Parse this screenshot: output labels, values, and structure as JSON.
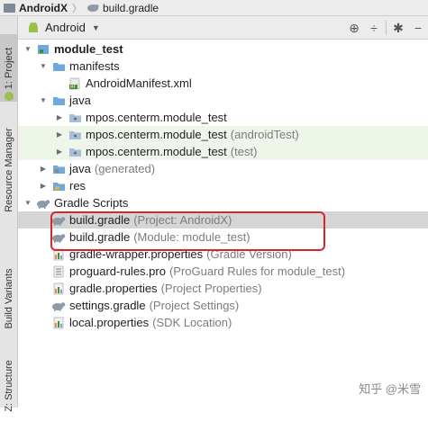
{
  "breadcrumb": {
    "project": "AndroidX",
    "file": "build.gradle"
  },
  "left_tabs": [
    {
      "label": "1: Project"
    },
    {
      "label": "Resource Manager"
    },
    {
      "label": "Build Variants"
    },
    {
      "label": "Z: Structure"
    }
  ],
  "header": {
    "view_mode": "Android",
    "tool_icons": [
      "target-icon",
      "collapse-icon",
      "gear-icon",
      "hide-icon"
    ]
  },
  "tree": [
    {
      "label": "module_test",
      "suffix": "",
      "bold": true,
      "level": 0,
      "arrow": "down",
      "icon": "module-icon"
    },
    {
      "label": "manifests",
      "suffix": "",
      "level": 1,
      "arrow": "down",
      "icon": "folder-icon"
    },
    {
      "label": "AndroidManifest.xml",
      "suffix": "",
      "level": 2,
      "arrow": "",
      "icon": "manifest-icon"
    },
    {
      "label": "java",
      "suffix": "",
      "level": 1,
      "arrow": "down",
      "icon": "folder-icon"
    },
    {
      "label": "mpos.centerm.module_test",
      "suffix": "",
      "level": 2,
      "arrow": "right",
      "icon": "package-icon"
    },
    {
      "label": "mpos.centerm.module_test",
      "suffix": "(androidTest)",
      "level": 2,
      "arrow": "right",
      "icon": "package-icon",
      "test": true
    },
    {
      "label": "mpos.centerm.module_test",
      "suffix": "(test)",
      "level": 2,
      "arrow": "right",
      "icon": "package-icon",
      "test": true
    },
    {
      "label": "java",
      "suffix": "(generated)",
      "level": 1,
      "arrow": "right",
      "icon": "generated-folder-icon"
    },
    {
      "label": "res",
      "suffix": "",
      "level": 1,
      "arrow": "right",
      "icon": "res-folder-icon"
    },
    {
      "label": "Gradle Scripts",
      "suffix": "",
      "level": 0,
      "arrow": "down",
      "icon": "gradle-icon"
    },
    {
      "label": "build.gradle",
      "suffix": "(Project: AndroidX)",
      "level": 1,
      "arrow": "",
      "icon": "gradle-icon",
      "selected": true
    },
    {
      "label": "build.gradle",
      "suffix": "(Module: module_test)",
      "level": 1,
      "arrow": "",
      "icon": "gradle-icon"
    },
    {
      "label": "gradle-wrapper.properties",
      "suffix": "(Gradle Version)",
      "level": 1,
      "arrow": "",
      "icon": "properties-icon"
    },
    {
      "label": "proguard-rules.pro",
      "suffix": "(ProGuard Rules for module_test)",
      "level": 1,
      "arrow": "",
      "icon": "pro-file-icon"
    },
    {
      "label": "gradle.properties",
      "suffix": "(Project Properties)",
      "level": 1,
      "arrow": "",
      "icon": "properties-icon"
    },
    {
      "label": "settings.gradle",
      "suffix": "(Project Settings)",
      "level": 1,
      "arrow": "",
      "icon": "gradle-icon"
    },
    {
      "label": "local.properties",
      "suffix": "(SDK Location)",
      "level": 1,
      "arrow": "",
      "icon": "properties-icon"
    }
  ],
  "watermark": "知乎 @米雪",
  "colors": {
    "highlight_box": "#d9252b",
    "selected_row": "#d5d5d5",
    "test_row": "#eef6ea",
    "folder": "#6fa8dc",
    "android_green": "#9bc14b"
  }
}
